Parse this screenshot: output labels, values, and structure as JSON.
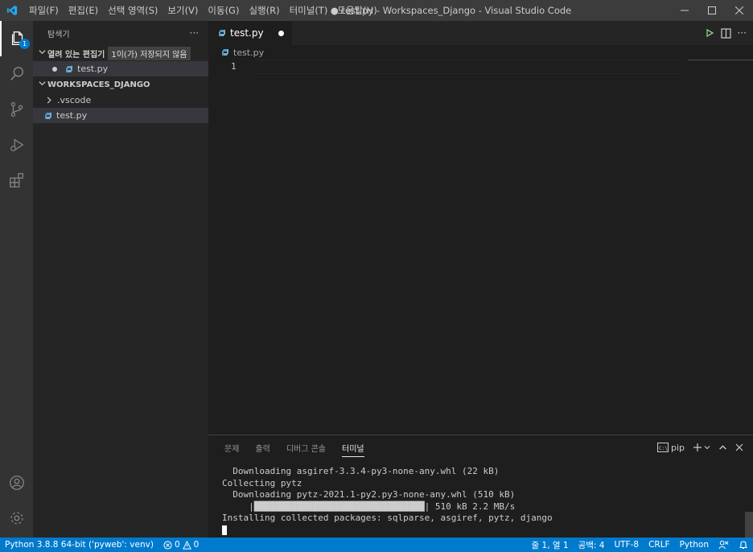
{
  "titlebar": {
    "menu": [
      "파일(F)",
      "편집(E)",
      "선택 영역(S)",
      "보기(V)",
      "이동(G)",
      "실행(R)",
      "터미널(T)",
      "도움말(H)"
    ],
    "title": "● test.py - Workspaces_Django - Visual Studio Code"
  },
  "activitybar": {
    "explorer_badge": "1"
  },
  "sidebar": {
    "header": "탐색기",
    "more": "···",
    "open_editors": {
      "label": "열려 있는 편집기",
      "unsaved_tooltip": "1이(가) 저장되지 않음",
      "file": "test.py"
    },
    "workspace": {
      "label": "WORKSPACES_DJANGO",
      "folder": ".vscode",
      "file": "test.py"
    }
  },
  "editor": {
    "tab_label": "test.py",
    "breadcrumb": "test.py",
    "line_number": "1"
  },
  "panel": {
    "tabs": [
      "문제",
      "출력",
      "디버그 콘솔",
      "터미널"
    ],
    "active_tab": "터미널",
    "terminal_name": "pip",
    "terminal_lines": [
      "  Downloading asgiref-3.3.4-py3-none-any.whl (22 kB)",
      "Collecting pytz",
      "  Downloading pytz-2021.1-py2.py3-none-any.whl (510 kB)",
      "     |████████████████████████████████| 510 kB 2.2 MB/s",
      "Installing collected packages: sqlparse, asgiref, pytz, django"
    ]
  },
  "statusbar": {
    "interpreter": "Python 3.8.8 64-bit ('pyweb': venv)",
    "errors": "0",
    "warnings": "0",
    "position": "줄 1, 열 1",
    "spaces": "공백: 4",
    "encoding": "UTF-8",
    "eol": "CRLF",
    "language": "Python"
  },
  "colors": {
    "accent": "#007acc",
    "titlebar": "#3c3c3c",
    "sidebar": "#252526",
    "editor": "#1e1e1e",
    "activitybar": "#333333"
  }
}
